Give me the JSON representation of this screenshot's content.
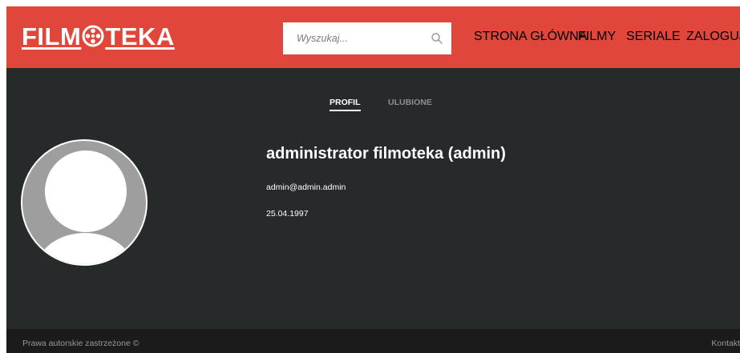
{
  "header": {
    "logo_left": "FILM",
    "logo_right": "TEKA",
    "search": {
      "placeholder": "Wyszukaj..."
    },
    "nav": [
      {
        "label": "STRONA GŁÓWNA"
      },
      {
        "label": "FILMY"
      },
      {
        "label": "SERIALE"
      },
      {
        "label": "ZALOGUJ"
      }
    ]
  },
  "tabs": [
    {
      "label": "PROFIL",
      "active": true
    },
    {
      "label": "ULUBIONE",
      "active": false
    }
  ],
  "profile": {
    "display_name": "administrator filmoteka (admin)",
    "email": "admin@admin.admin",
    "birth_date": "25.04.1997"
  },
  "footer": {
    "copyright": "Prawa autorskie zastrzeżone ©",
    "contact": "Kontakt"
  },
  "colors": {
    "brand_red": "#e0463a",
    "background": "#262a2b",
    "footer": "#1b1b1b"
  }
}
